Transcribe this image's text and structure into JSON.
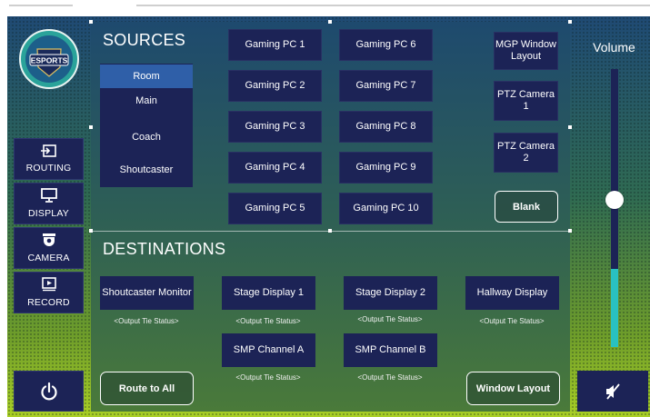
{
  "branding": {
    "logo_text": "ESPORTS"
  },
  "sidebar": {
    "items": [
      {
        "label": "ROUTING",
        "icon": "routing-icon"
      },
      {
        "label": "DISPLAY",
        "icon": "display-icon"
      },
      {
        "label": "CAMERA",
        "icon": "camera-icon"
      },
      {
        "label": "RECORD",
        "icon": "record-icon"
      }
    ],
    "power_icon": "power-icon"
  },
  "sources": {
    "title": "SOURCES",
    "list": [
      "Room",
      "Main",
      "Coach",
      "Shoutcaster"
    ],
    "selected": "Room",
    "gaming_col1": [
      "Gaming PC 1",
      "Gaming PC 2",
      "Gaming PC 3",
      "Gaming PC 4",
      "Gaming PC 5"
    ],
    "gaming_col2": [
      "Gaming PC 6",
      "Gaming PC 7",
      "Gaming PC 8",
      "Gaming PC 9",
      "Gaming PC 10"
    ],
    "right_buttons": [
      "MGP Window Layout",
      "PTZ Camera 1",
      "PTZ Camera 2"
    ],
    "blank_label": "Blank"
  },
  "destinations": {
    "title": "DESTINATIONS",
    "row1": [
      "Shoutcaster Monitor",
      "Stage Display 1",
      "Stage Display 2",
      "Hallway Display"
    ],
    "row2": [
      "SMP Channel A",
      "SMP Channel B"
    ],
    "status_text": "<Output Tie Status>",
    "route_all_label": "Route to All",
    "window_layout_label": "Window Layout"
  },
  "volume": {
    "label": "Volume",
    "level": 0.28,
    "thumb_level": 0.53
  },
  "colors": {
    "button": "#1c2356",
    "selected": "#2f5fa8",
    "volume_fill": "#29c1c1"
  }
}
